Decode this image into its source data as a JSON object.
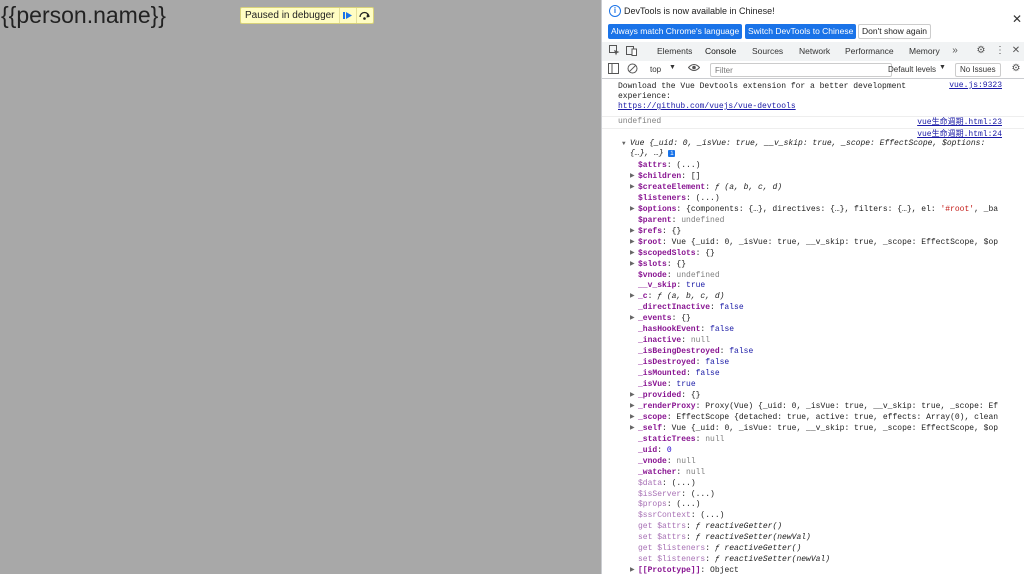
{
  "page": {
    "heading": "{{person.name}}"
  },
  "debugger": {
    "label": "Paused in debugger"
  },
  "infobar": {
    "message": "DevTools is now available in Chinese!",
    "buttons": [
      "Always match Chrome's language",
      "Switch DevTools to Chinese",
      "Don't show again"
    ]
  },
  "tabs": [
    "Elements",
    "Console",
    "Sources",
    "Network",
    "Performance",
    "Memory"
  ],
  "console_toolbar": {
    "context": "top",
    "filter_placeholder": "Filter",
    "levels": "Default levels",
    "issues": "No Issues"
  },
  "messages": {
    "vue_tip_line1": "Download the Vue Devtools extension for a better development",
    "vue_tip_line2": "experience:",
    "vue_tip_link": "https://github.com/vuejs/vue-devtools",
    "vue_tip_source": "vue.js:9323",
    "undefined_text": "undefined",
    "source_23": "vue生命週期.html:23",
    "source_24": "vue生命週期.html:24",
    "vue_summary_1": "Vue {_uid: 0, _isVue: true, __v_skip: true, _scope: EffectScope, $options:",
    "vue_summary_2": "{…}, …}",
    "properties": [
      "$attrs: (...)",
      "$children: []",
      "$createElement: ƒ (a, b, c, d)",
      "$listeners: (...)",
      "$options: {components: {…}, directives: {…}, filters: {…}, el: '#root', _ba",
      "$parent: undefined",
      "$refs: {}",
      "$root: Vue {_uid: 0, _isVue: true, __v_skip: true, _scope: EffectScope, $op",
      "$scopedSlots: {}",
      "$slots: {}",
      "$vnode: undefined",
      "__v_skip: true",
      "_c: ƒ (a, b, c, d)",
      "_directInactive: false",
      "_events: {}",
      "_hasHookEvent: false",
      "_inactive: null",
      "_isBeingDestroyed: false",
      "_isDestroyed: false",
      "_isMounted: false",
      "_isVue: true",
      "_provided: {}",
      "_renderProxy: Proxy(Vue) {_uid: 0, _isVue: true, __v_skip: true, _scope: Ef",
      "_scope: EffectScope {detached: true, active: true, effects: Array(0), clean",
      "_self: Vue {_uid: 0, _isVue: true, __v_skip: true, _scope: EffectScope, $op",
      "_staticTrees: null",
      "_uid: 0",
      "_vnode: null",
      "_watcher: null",
      "$data: (...)",
      "$isServer: (...)",
      "$props: (...)",
      "$ssrContext: (...)",
      "get $attrs: ƒ reactiveGetter()",
      "set $attrs: ƒ reactiveSetter(newVal)",
      "get $listeners: ƒ reactiveGetter()",
      "set $listeners: ƒ reactiveSetter(newVal)",
      "[[Prototype]]: Object"
    ]
  },
  "colors": {
    "page_bg": "#a8a8a8",
    "accent": "#1a73e8",
    "key": "#881391",
    "string": "#c41a16",
    "number": "#1c00cf"
  }
}
